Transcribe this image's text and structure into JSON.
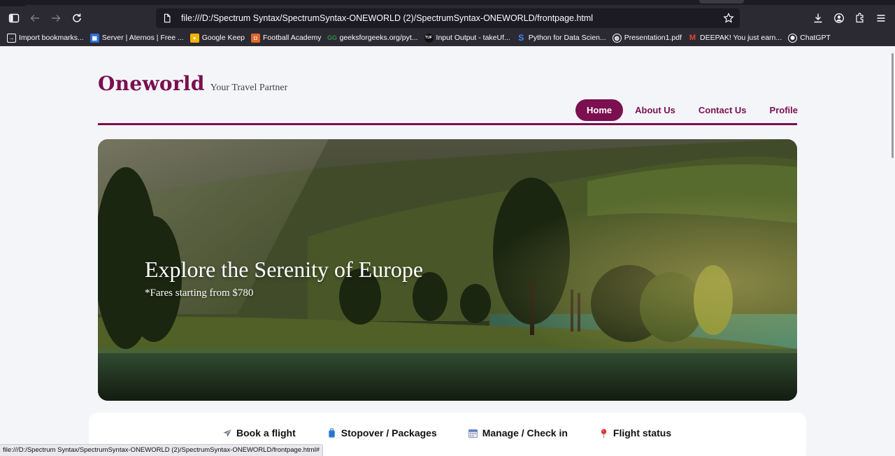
{
  "browser": {
    "url": "file:///D:/Spectrum Syntax/SpectrumSyntax-ONEWORLD (2)/SpectrumSyntax-ONEWORLD/frontpage.html",
    "status_url": "file:///D:/Spectrum Syntax/SpectrumSyntax-ONEWORLD (2)/SpectrumSyntax-ONEWORLD/frontpage.html#",
    "bookmarks": [
      {
        "label": "Import bookmarks...",
        "icon": "import-icon"
      },
      {
        "label": "Server | Aternos | Free ...",
        "icon": "aternos-icon"
      },
      {
        "label": "Google Keep",
        "icon": "keep-icon"
      },
      {
        "label": "Football Academy",
        "icon": "academy-icon"
      },
      {
        "label": "geeksforgeeks.org/pyt...",
        "icon": "gfg-icon"
      },
      {
        "label": "Input Output - takeUf...",
        "icon": "tuf-icon"
      },
      {
        "label": "Python for Data Scien...",
        "icon": "s-icon"
      },
      {
        "label": "Presentation1.pdf",
        "icon": "globe-icon"
      },
      {
        "label": "DEEPAK! You just earn...",
        "icon": "gmail-icon"
      },
      {
        "label": "ChatGPT",
        "icon": "chatgpt-icon"
      }
    ]
  },
  "site": {
    "logo": "Oneworld",
    "tagline": "Your Travel Partner",
    "nav": [
      {
        "label": "Home",
        "active": true
      },
      {
        "label": "About Us",
        "active": false
      },
      {
        "label": "Contact Us",
        "active": false
      },
      {
        "label": "Profile",
        "active": false
      }
    ],
    "brand_color": "#7b0f4f"
  },
  "hero": {
    "title": "Explore the Serenity of Europe",
    "subtitle": "*Fares starting from $780"
  },
  "options": [
    {
      "label": "Book a flight",
      "icon": "airplane-icon"
    },
    {
      "label": "Stopover / Packages",
      "icon": "luggage-icon"
    },
    {
      "label": "Manage / Check in",
      "icon": "calendar-icon"
    },
    {
      "label": "Flight status",
      "icon": "pin-icon"
    }
  ]
}
